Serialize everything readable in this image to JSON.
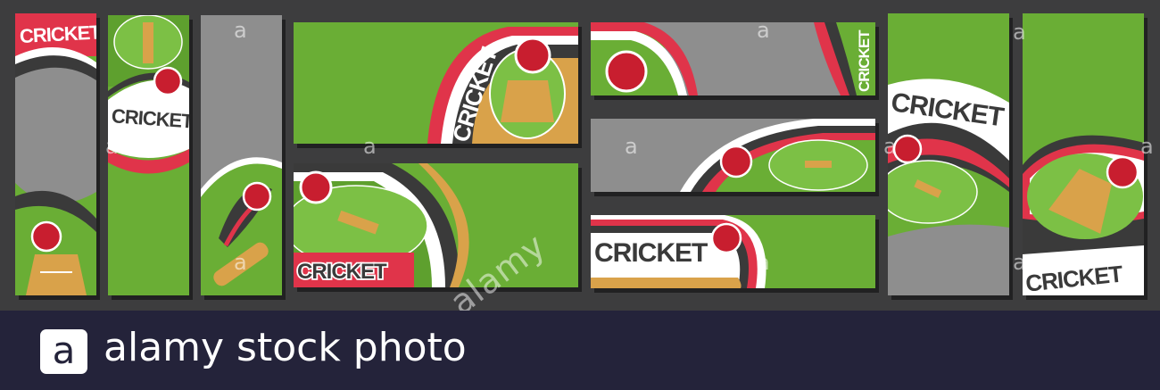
{
  "banner_word": "CRICKET",
  "watermark": {
    "small_letter": "a",
    "diagonal_text": "alamy"
  },
  "footer": {
    "logo_letter": "a",
    "text": "alamy stock photo"
  },
  "colors": {
    "grass": "#6aae35",
    "grass_dark": "#4f8f27",
    "grey": "#8e8e8e",
    "dark_band": "#3a3a3a",
    "red": "#e0344a",
    "wood": "#d9a24a",
    "ball": "#c81e2f",
    "footer_bg": "#24233a"
  }
}
